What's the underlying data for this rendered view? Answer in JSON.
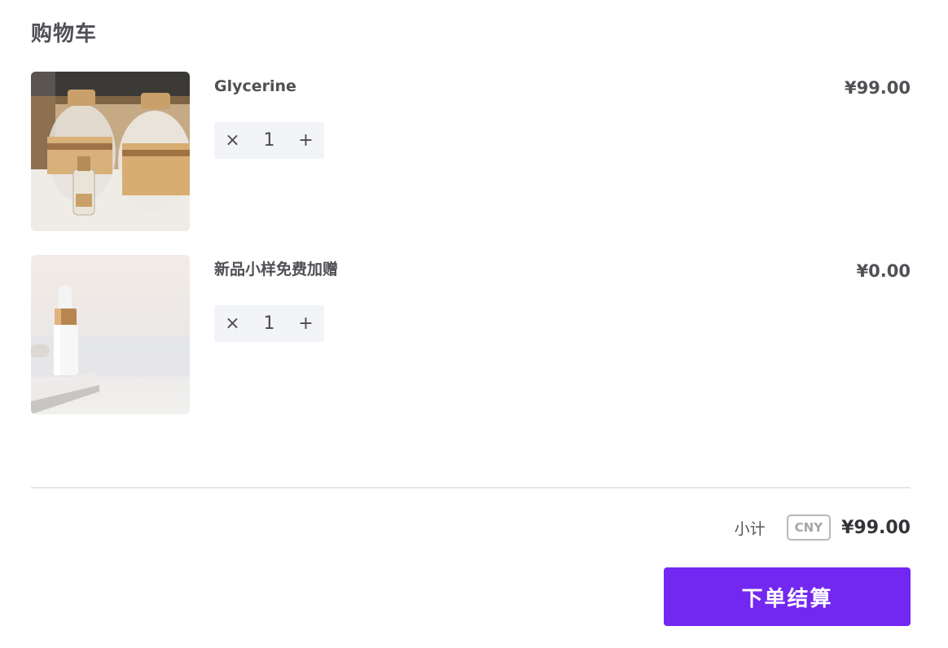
{
  "cart": {
    "title": "购物车",
    "items": [
      {
        "name": "Glycerine",
        "price": "¥99.00",
        "quantity": "1",
        "decrease_symbol": "×",
        "increase_symbol": "+",
        "image": "glycerine-bottles-photo"
      },
      {
        "name": "新品小样免费加赠",
        "price": "¥0.00",
        "quantity": "1",
        "decrease_symbol": "×",
        "increase_symbol": "+",
        "image": "serum-dropper-bottle-photo"
      }
    ]
  },
  "summary": {
    "subtotal_label": "小计",
    "currency": "CNY",
    "total": "¥99.00"
  },
  "checkout": {
    "label": "下单结算"
  },
  "colors": {
    "accent": "#7228f0",
    "stepper_bg": "#f3f4f8",
    "text": "#505055"
  }
}
